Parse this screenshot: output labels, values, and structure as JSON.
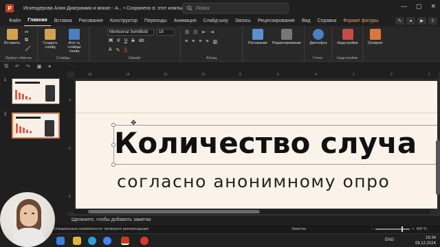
{
  "window": {
    "title": "Искендерова Алия Диаграмма и мокап - А... • Сохранено в: этот компьютер",
    "app_letter": "P",
    "minimize": "—",
    "maximize": "▢",
    "close": "✕"
  },
  "search": {
    "placeholder": "Поиск"
  },
  "tabs": [
    "Файл",
    "Главная",
    "Вставка",
    "Рисование",
    "Конструктор",
    "Переходы",
    "Анимация",
    "Слайд-шоу",
    "Запись",
    "Рецензирование",
    "Вид",
    "Справка",
    "Формат фигуры"
  ],
  "ribbon": {
    "paste": "Вставить",
    "clipboard_label": "Буфер обмена",
    "new_slide": "Создать слайд",
    "reuse_slides": "Исп-ть слайды снова",
    "slides_label": "Слайды",
    "font_name": "Montserrat SemiBold",
    "font_size": "18",
    "font_label": "Шрифт",
    "paragraph_label": "Абзац",
    "drawing": "Рисование",
    "editing": "Редактирование",
    "dictation": "Диктофон",
    "voice_label": "Голос",
    "addins": "Надстройки",
    "addins_label": "Надстройки",
    "designer": "Designer"
  },
  "ruler": {
    "h_ticks": [
      "16",
      "14",
      "12",
      "10",
      "8",
      "6",
      "4",
      "2",
      "0",
      "2",
      "4",
      "6",
      "8",
      "10",
      "12"
    ],
    "v_ticks": [
      "4",
      "6",
      "8"
    ]
  },
  "slides": [
    {
      "number": "1"
    },
    {
      "number": "2"
    }
  ],
  "slide": {
    "title": "Количество случа",
    "subtitle": "согласно анонимному опро"
  },
  "notes": {
    "placeholder": "Щелкните, чтобы добавить заметки"
  },
  "status": {
    "accessibility": "Специальные возможности: проверьте рекомендации",
    "notes_button": "Заметки",
    "zoom": "400 %"
  },
  "taskbar": {
    "lang": "ENG",
    "time": "18:34",
    "date": "09.12.2024"
  },
  "colors": {
    "accent": "#c43e1c",
    "shape_tab": "#e9a36a",
    "slide_bg": "#fbf3e9"
  }
}
